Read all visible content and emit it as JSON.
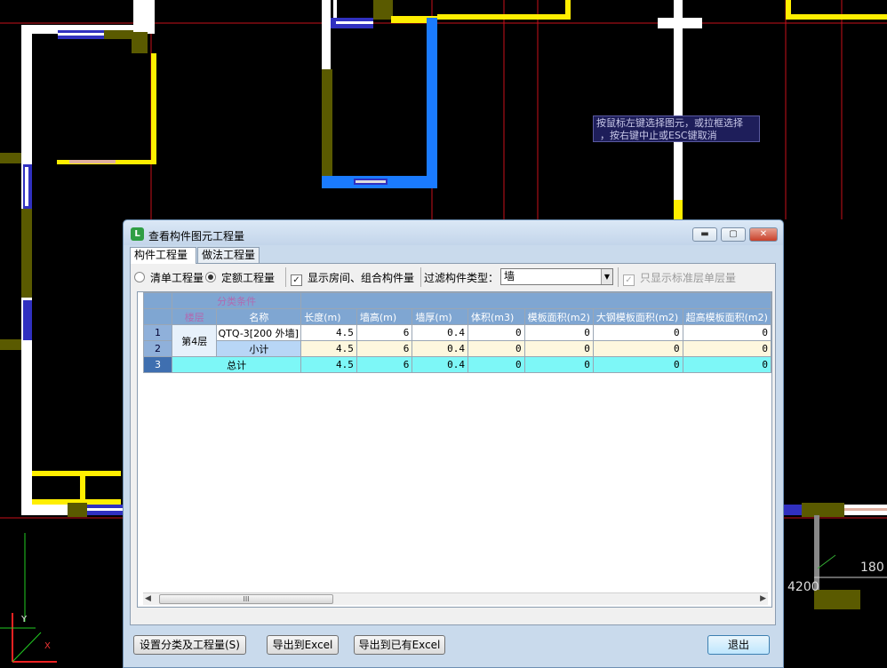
{
  "cad": {
    "tooltip_line1": "按鼠标左键选择图元，或拉框选择",
    "tooltip_line2": "，按右键中止或ESC键取消",
    "dim1": "4200",
    "dim2": "180",
    "axis_y": "Y",
    "axis_x": "X",
    "colors": {
      "wall": "#ffffff",
      "column": "#5a5a00",
      "highlight": "#ffee00",
      "selected": "#1a7bff",
      "grid": "#c8101a",
      "window": "#3030c0"
    }
  },
  "dialog": {
    "title": "查看构件图元工程量",
    "icon_label": "L",
    "min_symbol": "▬",
    "max_symbol": "▢",
    "close_symbol": "✕",
    "tabs": [
      "构件工程量",
      "做法工程量"
    ],
    "options": {
      "radio_list": "清单工程量",
      "radio_quota": "定额工程量",
      "chk_room": "显示房间、组合构件量",
      "chk_room_mark": "✓",
      "filter_label": "过滤构件类型：",
      "filter_value": "墙",
      "filter_arrow": "▼",
      "chk_std": "只显示标准层单层量",
      "chk_std_mark": "✓"
    },
    "table": {
      "group_header": "分类条件",
      "headers": [
        "楼层",
        "名称",
        "长度(m)",
        "墙高(m)",
        "墙厚(m)",
        "体积(m3)",
        "模板面积(m2)",
        "大钢模板面积(m2)",
        "超高模板面积(m2)"
      ],
      "rows": [
        {
          "num": "1",
          "floor": "第4层",
          "name": "QTQ-3[200 外墙]",
          "length": "4.5",
          "height": "6",
          "thick": "0.4",
          "volume": "0",
          "formwork": "0",
          "steel": "0",
          "super": "0"
        },
        {
          "num": "2",
          "name": "小计",
          "length": "4.5",
          "height": "6",
          "thick": "0.4",
          "volume": "0",
          "formwork": "0",
          "steel": "0",
          "super": "0"
        },
        {
          "num": "3",
          "name": "总计",
          "length": "4.5",
          "height": "6",
          "thick": "0.4",
          "volume": "0",
          "formwork": "0",
          "steel": "0",
          "super": "0"
        }
      ]
    },
    "scroll": {
      "left": "◀",
      "right": "▶",
      "thumb": "III"
    },
    "buttons": {
      "settings": "设置分类及工程量(S)",
      "export": "导出到Excel",
      "export_existing": "导出到已有Excel",
      "exit": "退出"
    }
  }
}
